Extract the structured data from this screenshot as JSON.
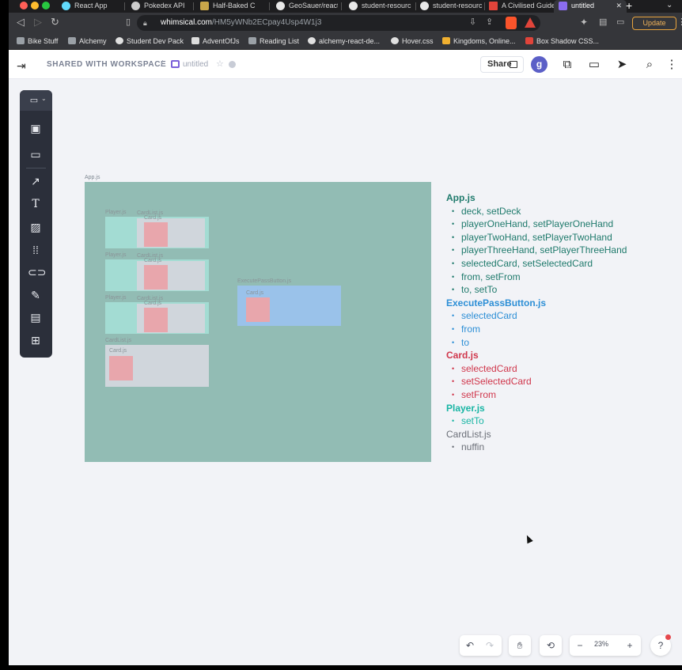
{
  "browser": {
    "tabs": [
      {
        "title": "React App"
      },
      {
        "title": "Pokedex API"
      },
      {
        "title": "Half-Baked C"
      },
      {
        "title": "GeoSauer/react"
      },
      {
        "title": "student-resourc"
      },
      {
        "title": "student-resourc"
      },
      {
        "title": "A Civilised Guide"
      },
      {
        "title": "untitled"
      }
    ],
    "url_host": "whimsical.com",
    "url_path": "/HM5yWNb2ECpay4Usp4W1j3",
    "update_label": "Update",
    "bookmarks": [
      {
        "label": "Bike Stuff"
      },
      {
        "label": "Alchemy"
      },
      {
        "label": "Student Dev Pack"
      },
      {
        "label": "AdventOfJs"
      },
      {
        "label": "Reading List"
      },
      {
        "label": "alchemy-react-de..."
      },
      {
        "label": "Hover.css"
      },
      {
        "label": "Kingdoms, Online..."
      },
      {
        "label": "Box Shadow CSS..."
      }
    ]
  },
  "header": {
    "workspace": "SHARED WITH WORKSPACE",
    "separator": "/",
    "doc_title": "untitled",
    "share_label": "Share",
    "avatar_letter": "g"
  },
  "diagram": {
    "app_label": "App.js",
    "player_label": "Player.js",
    "cardlist_label": "CardList.js",
    "card_label": "Card.js",
    "epb_label": "ExecutePassButton.js"
  },
  "notes": [
    {
      "heading": "App.js",
      "color": "#1f7a6c",
      "bold": true,
      "items": [
        "deck, setDeck",
        "playerOneHand, setPlayerOneHand",
        "playerTwoHand, setPlayerTwoHand",
        "playerThreeHand, setPlayerThreeHand",
        "selectedCard, setSelectedCard",
        "from, setFrom",
        "to, setTo"
      ]
    },
    {
      "heading": "ExecutePassButton.js",
      "color": "#2d8fd6",
      "bold": true,
      "items": [
        "selectedCard",
        "from",
        "to"
      ]
    },
    {
      "heading": "Card.js",
      "color": "#d0374c",
      "bold": true,
      "items": [
        "selectedCard",
        "setSelectedCard",
        "setFrom"
      ]
    },
    {
      "heading": "Player.js",
      "color": "#18b5a4",
      "bold": true,
      "items": [
        "setTo"
      ]
    },
    {
      "heading": "CardList.js",
      "color": "#6b6f78",
      "bold": false,
      "items": [
        "nuffin"
      ]
    }
  ],
  "controls": {
    "zoom": "23%",
    "help": "?"
  },
  "icons": {
    "toolbar": [
      "board-icon",
      "card-check-icon",
      "browser-frame-icon",
      "arrow-icon",
      "text-icon",
      "image-icon",
      "grid-icon",
      "link-icon",
      "pen-icon",
      "section-icon",
      "add-icon"
    ]
  }
}
